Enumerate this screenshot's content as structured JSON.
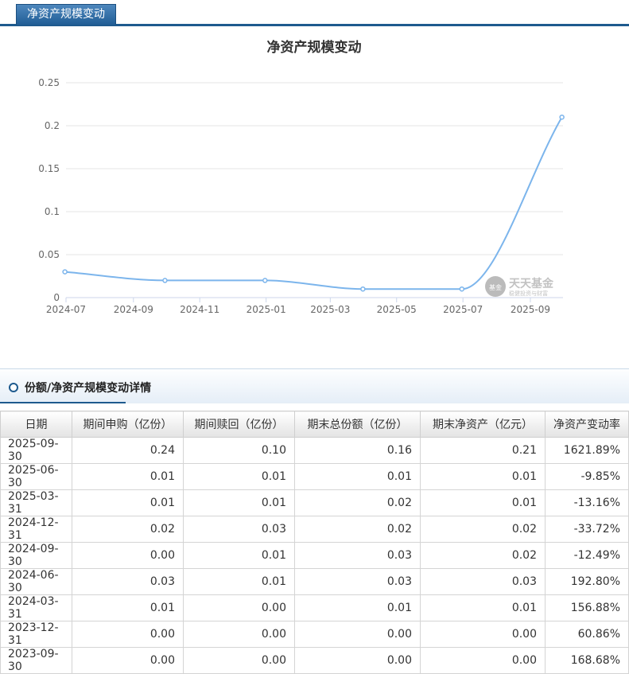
{
  "tab": {
    "label": "净资产规模变动"
  },
  "chart_data": {
    "type": "line",
    "title": "净资产规模变动",
    "x": [
      "2024-06-30",
      "2024-09-30",
      "2024-12-31",
      "2025-03-31",
      "2025-06-30",
      "2025-09-30"
    ],
    "series": [
      {
        "values": [
          0.03,
          0.02,
          0.02,
          0.01,
          0.01,
          0.21
        ]
      }
    ],
    "x_ticks": [
      "2024-07",
      "2024-09",
      "2024-11",
      "2025-01",
      "2025-03",
      "2025-05",
      "2025-07",
      "2025-09"
    ],
    "y_ticks": [
      "0",
      "0.05",
      "0.1",
      "0.15",
      "0.2",
      "0.25"
    ],
    "ylim": [
      0,
      0.25
    ],
    "grid": true,
    "line_color": "#7cb5ec",
    "watermark": {
      "cn": "天天基金",
      "sub": "稳健投资与财富",
      "logo": "基金"
    }
  },
  "details": {
    "heading": "份额/净资产规模变动详情",
    "columns": [
      "日期",
      "期间申购（亿份）",
      "期间赎回（亿份）",
      "期末总份额（亿份）",
      "期末净资产（亿元）",
      "净资产变动率"
    ],
    "rows": [
      [
        "2025-09-30",
        "0.24",
        "0.10",
        "0.16",
        "0.21",
        "1621.89%"
      ],
      [
        "2025-06-30",
        "0.01",
        "0.01",
        "0.01",
        "0.01",
        "-9.85%"
      ],
      [
        "2025-03-31",
        "0.01",
        "0.01",
        "0.02",
        "0.01",
        "-13.16%"
      ],
      [
        "2024-12-31",
        "0.02",
        "0.03",
        "0.02",
        "0.02",
        "-33.72%"
      ],
      [
        "2024-09-30",
        "0.00",
        "0.01",
        "0.03",
        "0.02",
        "-12.49%"
      ],
      [
        "2024-06-30",
        "0.03",
        "0.01",
        "0.03",
        "0.03",
        "192.80%"
      ],
      [
        "2024-03-31",
        "0.01",
        "0.00",
        "0.01",
        "0.01",
        "156.88%"
      ],
      [
        "2023-12-31",
        "0.00",
        "0.00",
        "0.00",
        "0.00",
        "60.86%"
      ],
      [
        "2023-09-30",
        "0.00",
        "0.00",
        "0.00",
        "0.00",
        "168.68%"
      ]
    ]
  }
}
